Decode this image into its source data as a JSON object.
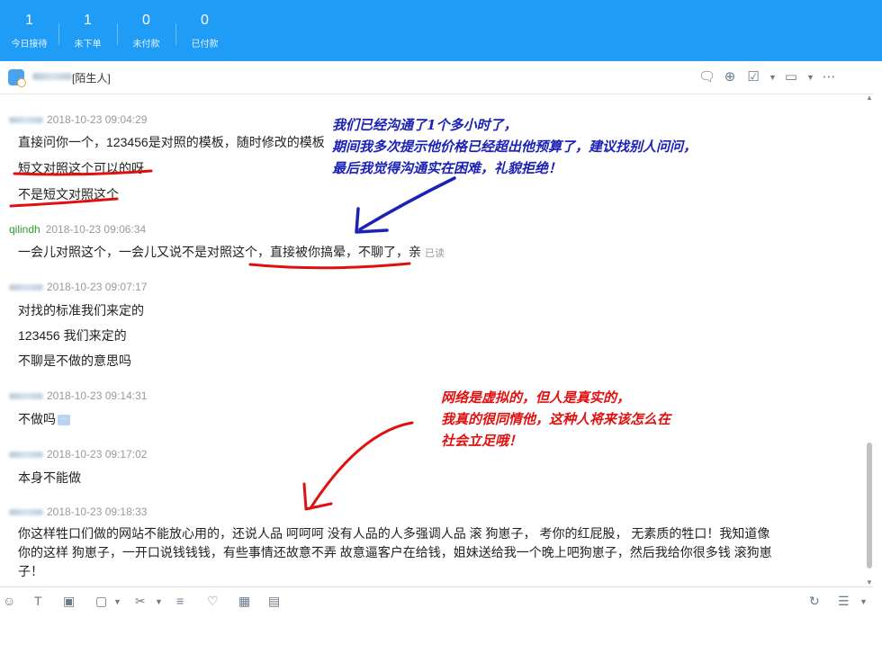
{
  "stats": [
    {
      "value": "1",
      "label": "今日接待"
    },
    {
      "value": "1",
      "label": "未下单"
    },
    {
      "value": "0",
      "label": "未付款"
    },
    {
      "value": "0",
      "label": "已付款"
    }
  ],
  "chat_header": {
    "tag": "[陌生人]"
  },
  "header_icons": [
    "chat-bubble-icon",
    "add-contact-icon",
    "checklist-icon",
    "video-icon",
    "more-icon"
  ],
  "messages": [
    {
      "time": "2018-10-23 09:04:29",
      "lines": [
        "直接问你一个，123456是对照的模板，随时修改的模板",
        "短文对照这个可以的呀",
        "不是短文对照这个"
      ]
    },
    {
      "sender": "qilindh",
      "time": "2018-10-23 09:06:34",
      "lines": [
        "一会儿对照这个，一会儿又说不是对照这个，直接被你搞晕，不聊了，亲"
      ],
      "read": "已读"
    },
    {
      "time": "2018-10-23 09:07:17",
      "lines": [
        "对找的标准我们来定的",
        "123456  我们来定的",
        "不聊是不做的意思吗"
      ]
    },
    {
      "time": "2018-10-23 09:14:31",
      "lines": [
        "不做吗"
      ]
    },
    {
      "time": "2018-10-23 09:17:02",
      "lines": [
        "本身不能做"
      ]
    },
    {
      "time": "2018-10-23 09:18:33",
      "lines": [
        "你这样牲口们做的网站不能放心用的，还说人品  呵呵呵  没有人品的人多强调人品   滚  狗崽子，  考你的红屁股，  无素质的牲口！我知道像你的这样  狗崽子，一开口说钱钱钱，有些事情还故意不弄  故意逼客户在给钱，姐妹送给我一个晚上吧狗崽子，然后我给你很多钱   滚狗崽子！"
      ]
    }
  ],
  "annotations": {
    "blue": [
      "我们已经沟通了1个多小时了，",
      "期间我多次提示他价格已经超出他预算了，建议找别人问问，",
      "最后我觉得沟通实在困难，礼貌拒绝！"
    ],
    "red": [
      "网络是虚拟的，但人是真实的，",
      "我真的很同情他，这种人将来该怎么在",
      "社会立足哦！"
    ]
  },
  "annotation_colors": {
    "blue": "#1c22b4",
    "red": "#e01010"
  },
  "toolbar_icons": [
    "emoji-icon",
    "text-format-icon",
    "image-icon",
    "folder-icon",
    "scissors-icon",
    "vibrate-icon",
    "heart-icon",
    "calculator-icon",
    "order-icon",
    "history-icon",
    "settings-icon"
  ],
  "colors": {
    "topbar": "#1f9cf5",
    "self_name": "#2f9a2f"
  }
}
